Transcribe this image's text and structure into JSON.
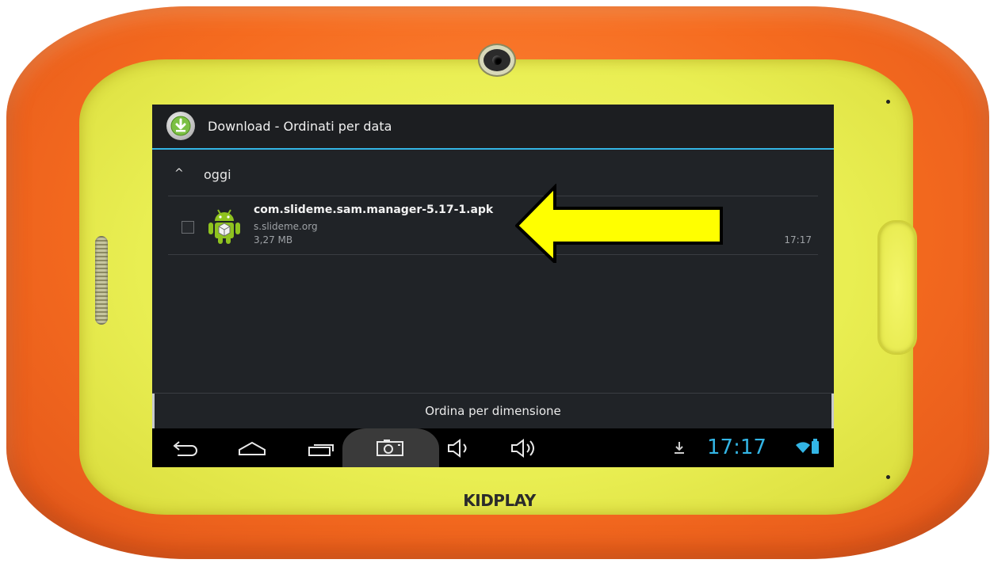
{
  "device": {
    "brand": "KIDPLAY",
    "bumper_color": "#f56b1f",
    "shell_color": "#e9ee52"
  },
  "screen": {
    "title": "Download - Ordinati per data",
    "title_icon": "download-icon",
    "group": {
      "expand_icon": "^",
      "label": "oggi"
    },
    "downloads": [
      {
        "filename": "com.slideme.sam.manager-5.17-1.apk",
        "source": "s.slideme.org",
        "size": "3,27 MB",
        "time": "17:17",
        "icon": "android-icon"
      }
    ],
    "sort_button": "Ordina per dimensione",
    "accent_color": "#33b5e5"
  },
  "navbar": {
    "buttons": [
      "back-icon",
      "home-icon",
      "recent-apps-icon",
      "screenshot-icon",
      "volume-down-icon",
      "volume-up-icon"
    ],
    "status": {
      "time": "17:17",
      "icons": [
        "download-status-icon",
        "wifi-icon",
        "battery-icon"
      ]
    }
  },
  "annotation": {
    "arrow_color": "#ffff00",
    "arrow_points_to": "download item"
  }
}
